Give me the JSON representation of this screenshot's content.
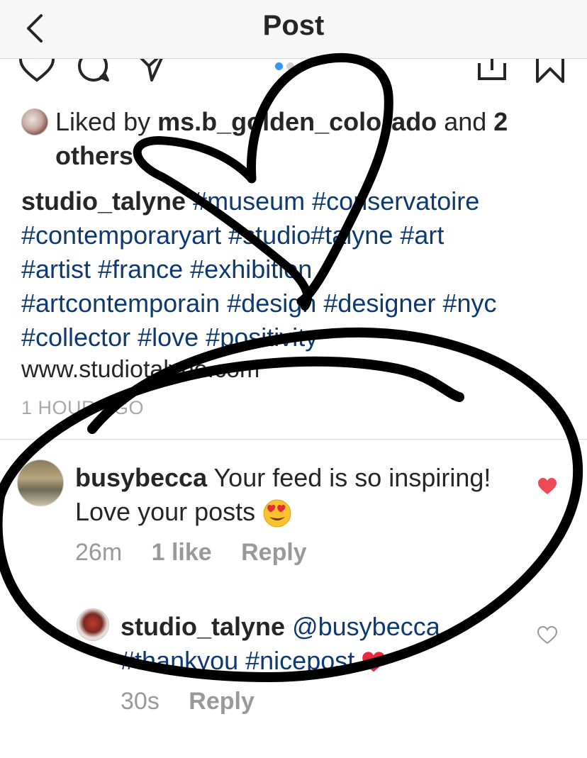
{
  "header": {
    "title": "Post"
  },
  "carousel": {
    "active_color": "#3897f0",
    "inactive_color": "#d0d0d0"
  },
  "likes": {
    "prefix": "Liked by",
    "user": "ms.b_golden_colorado",
    "joiner": "and",
    "count_text": "2 others"
  },
  "caption": {
    "username": "studio_talyne",
    "hashtags": [
      "#museum",
      "#conservatoire",
      "#contemporaryart",
      "#studio",
      "#talyne",
      "#art",
      "#artist",
      "#france",
      "#exhibition",
      "#artcontemporain",
      "#design",
      "#designer",
      "#nyc",
      "#collector",
      "#love",
      "#positivity"
    ],
    "website": "www.studiotalyne.com",
    "time_ago": "1 HOUR AGO"
  },
  "comments": [
    {
      "username": "busybecca",
      "text": "Your feed is so inspiring! Love your posts",
      "emoji": "heart-eyes",
      "age": "26m",
      "likes": "1 like",
      "reply_label": "Reply",
      "liked": true
    },
    {
      "username": "studio_talyne",
      "mention": "@busybecca",
      "text": "#thankyou #nicepost",
      "age": "30s",
      "reply_label": "Reply",
      "liked": false
    }
  ],
  "colors": {
    "hashtag": "#0d3a73",
    "like_heart": "#ed4956",
    "scribble": "#000000"
  },
  "icons": [
    "back-chevron-icon",
    "heart-icon",
    "comment-icon",
    "share-icon",
    "upload-icon",
    "bookmark-icon",
    "heart-eyes-emoji-icon",
    "heart-filled-icon",
    "heart-outline-icon"
  ]
}
